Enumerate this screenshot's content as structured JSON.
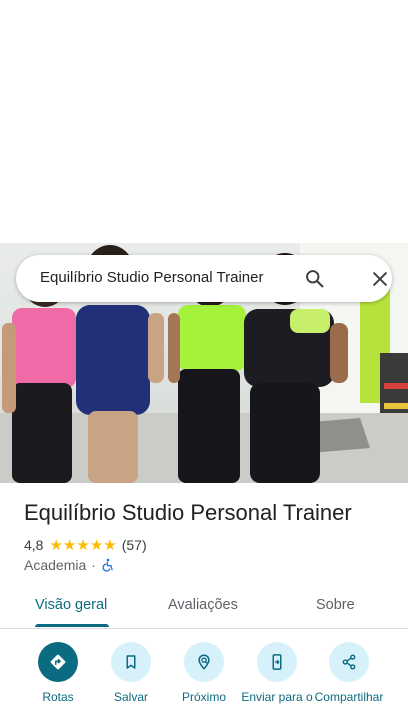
{
  "search": {
    "query": "Equilíbrio Studio Personal Trainer"
  },
  "place": {
    "name": "Equilíbrio Studio Personal Trainer",
    "rating": "4,8",
    "review_count": "(57)",
    "category": "Academia",
    "separator": "·",
    "stars_filled": 5
  },
  "tabs": [
    {
      "label": "Visão geral",
      "active": true
    },
    {
      "label": "Avaliações",
      "active": false
    },
    {
      "label": "Sobre",
      "active": false
    }
  ],
  "actions": [
    {
      "label": "Rotas",
      "icon": "directions-icon"
    },
    {
      "label": "Salvar",
      "icon": "bookmark-icon"
    },
    {
      "label": "Próximo",
      "icon": "nearby-icon"
    },
    {
      "label": "Enviar para o",
      "icon": "send-to-phone-icon"
    },
    {
      "label": "Compartilhar",
      "icon": "share-icon"
    }
  ],
  "colors": {
    "accent": "#0b6b80",
    "action_bg": "#d7f1fb",
    "star": "#fbbc04",
    "accessible": "#1a73e8"
  }
}
